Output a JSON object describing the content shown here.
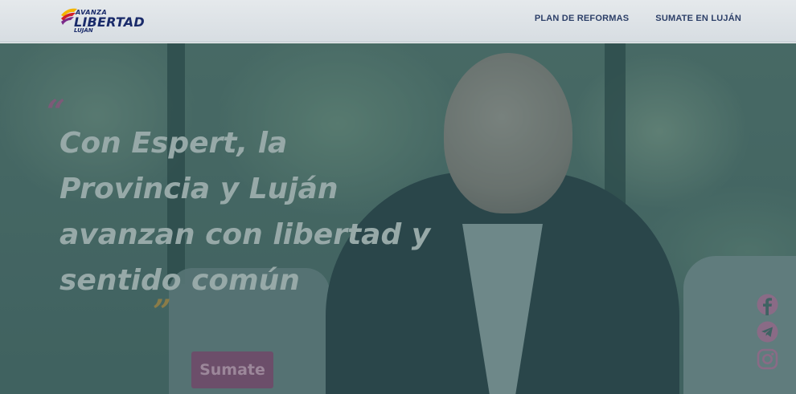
{
  "brand": {
    "line1": "AVANZA",
    "line2": "LIBERTAD",
    "line3": "LUJÁN"
  },
  "nav": {
    "items": [
      "PLAN DE REFORMAS",
      "SUMATE EN LUJÁN"
    ]
  },
  "hero": {
    "quote_open": "“",
    "headline": "Con Espert, la Provincia y Luján avanzan con libertad y sentido común",
    "quote_close": "”",
    "cta_label": "Sumate"
  },
  "social_icons": [
    "facebook-icon",
    "telegram-icon",
    "instagram-icon"
  ],
  "colors": {
    "nav_text": "#2c3f68",
    "cta": "#6c4e6a",
    "overlay": "#285055",
    "social": "#8a6b86"
  }
}
